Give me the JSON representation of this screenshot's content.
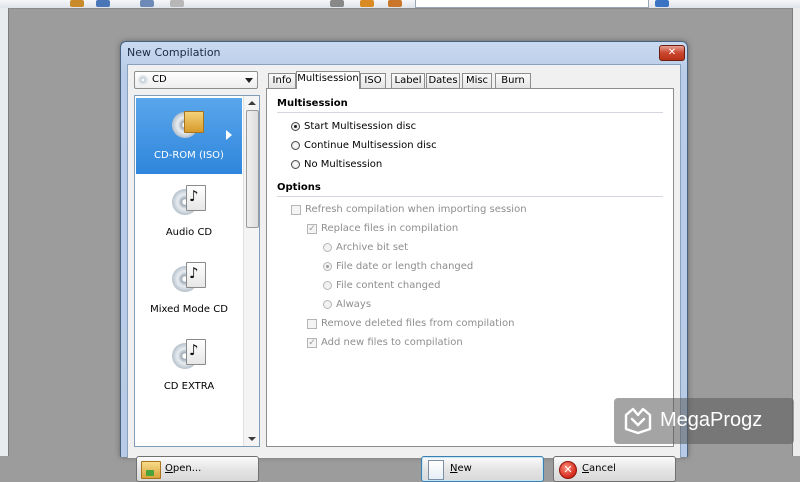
{
  "dialog": {
    "title": "New Compilation",
    "close_glyph": "✕"
  },
  "media_select": {
    "value": "CD",
    "icon": "disc-icon"
  },
  "media_list": {
    "items": [
      {
        "label": "CD-ROM (ISO)",
        "icon": "cdrom-iso-icon",
        "selected": true
      },
      {
        "label": "Audio CD",
        "icon": "audio-cd-icon",
        "selected": false
      },
      {
        "label": "Mixed Mode CD",
        "icon": "mixed-mode-cd-icon",
        "selected": false
      },
      {
        "label": "CD EXTRA",
        "icon": "cd-extra-icon",
        "selected": false
      }
    ]
  },
  "tabs": {
    "info": "Info",
    "multisession": "Multisession",
    "iso": "ISO",
    "label": "Label",
    "dates": "Dates",
    "misc": "Misc",
    "burn": "Burn",
    "active": "Multisession"
  },
  "multisession": {
    "heading": "Multisession",
    "options": [
      {
        "label": "Start Multisession disc",
        "selected": true
      },
      {
        "label": "Continue Multisession disc",
        "selected": false
      },
      {
        "label": "No Multisession",
        "selected": false
      }
    ]
  },
  "options": {
    "heading": "Options",
    "refresh": {
      "label": "Refresh compilation when importing session",
      "checked": false,
      "enabled": false
    },
    "replace": {
      "label": "Replace files in compilation",
      "checked": true,
      "enabled": false
    },
    "replace_modes": [
      {
        "label": "Archive bit set",
        "selected": false
      },
      {
        "label": "File date or length changed",
        "selected": true
      },
      {
        "label": "File content changed",
        "selected": false
      },
      {
        "label": "Always",
        "selected": false
      }
    ],
    "remove_deleted": {
      "label": "Remove deleted files from compilation",
      "checked": false,
      "enabled": false
    },
    "add_new": {
      "label": "Add new files to compilation",
      "checked": true,
      "enabled": false
    }
  },
  "buttons": {
    "open": "Open...",
    "new": "New",
    "cancel": "Cancel"
  },
  "watermark": {
    "text": "MegaProgz"
  },
  "colors": {
    "selection": "#3b8fe0",
    "title_bar": "#c9daf0",
    "close_button": "#c9452c"
  }
}
